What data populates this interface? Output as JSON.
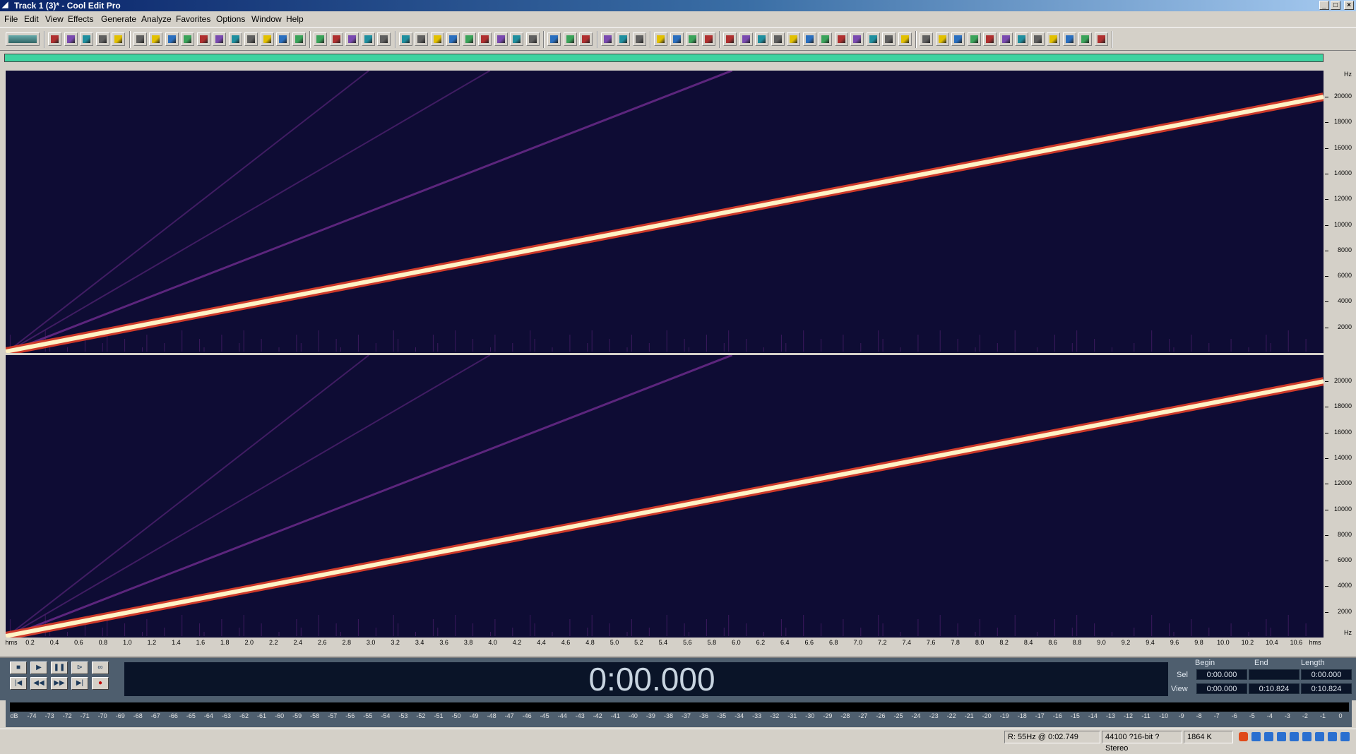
{
  "window": {
    "title": "Track 1 (3)* - Cool Edit Pro",
    "icon": "cool-edit-logo-icon",
    "buttons": {
      "minimize": "_",
      "maximize": "□",
      "close": "×"
    }
  },
  "menu": [
    "File",
    "Edit",
    "View",
    "Effects",
    "Generate",
    "Analyze",
    "Favorites",
    "Options",
    "Window",
    "Help"
  ],
  "toolbar": {
    "groups": [
      [
        "multitrack-icon"
      ],
      [
        "new-file-icon",
        "open-file-icon",
        "save-icon",
        "save-as-icon",
        "close-file-icon"
      ],
      [
        "undo-icon",
        "redo-icon",
        "repeat-icon",
        "copy-icon",
        "cut-icon",
        "paste-icon",
        "paste-new-icon",
        "mix-paste-icon",
        "trim-icon",
        "delete-icon",
        "silence-icon"
      ],
      [
        "waveform-view-icon",
        "spectral-view-icon",
        "zoom-in-icon",
        "zoom-out-icon",
        "zoom-full-icon"
      ],
      [
        "cue-list-icon",
        "play-list-icon",
        "snap-icon",
        "play-icon",
        "mark-icon",
        "time-format-icon",
        "grid-icon",
        "info-icon",
        "level-icon"
      ],
      [
        "settings-icon",
        "keyboard-icon",
        "help-icon"
      ],
      [
        "stats-icon",
        "find-icon",
        "zoom-region-icon"
      ],
      [
        "amplify-icon",
        "envelope-icon",
        "normalize-icon",
        "fade-icon"
      ],
      [
        "chorus-icon",
        "delay-icon",
        "echo-icon",
        "reverb-icon",
        "flanger-icon",
        "pitch-icon",
        "stretch-icon",
        "eq-icon",
        "filter-icon",
        "noise-icon",
        "hiss-icon",
        "click-icon"
      ],
      [
        "analyze-icon",
        "timer-icon",
        "gear-icon",
        "dynamics-icon",
        "wave-icon",
        "sine-icon",
        "tone-icon",
        "dtmf-icon",
        "brainwave-icon",
        "sweep-icon",
        "harmonic-icon",
        "spectrum-icon"
      ]
    ]
  },
  "spectrogram": {
    "hz_unit": "Hz",
    "hz_labels": [
      "20000",
      "18000",
      "16000",
      "14000",
      "12000",
      "10000",
      "8000",
      "6000",
      "4000",
      "2000"
    ],
    "bottom_hz_unit": "Hz",
    "time_labels": [
      "hms",
      "0.2",
      "0.4",
      "0.6",
      "0.8",
      "1.0",
      "1.2",
      "1.4",
      "1.6",
      "1.8",
      "2.0",
      "2.2",
      "2.4",
      "2.6",
      "2.8",
      "3.0",
      "3.2",
      "3.4",
      "3.6",
      "3.8",
      "4.0",
      "4.2",
      "4.4",
      "4.6",
      "4.8",
      "5.0",
      "5.2",
      "5.4",
      "5.6",
      "5.8",
      "6.0",
      "6.2",
      "6.4",
      "6.6",
      "6.8",
      "7.0",
      "7.2",
      "7.4",
      "7.6",
      "7.8",
      "8.0",
      "8.2",
      "8.4",
      "8.6",
      "8.8",
      "9.0",
      "9.2",
      "9.4",
      "9.6",
      "9.8",
      "10.0",
      "10.2",
      "10.4",
      "10.6",
      "hms"
    ],
    "background_color": "#0e0c34",
    "sweep_color": "#fff3c6",
    "glow_color": "#e2402a",
    "harmonic_color": "#6a2a8a",
    "sweep_end_hz": 20000,
    "max_hz": 22050
  },
  "transport": {
    "time": "0:00.000",
    "buttons": [
      "stop-icon",
      "play-icon",
      "pause-icon",
      "play-to-end-icon",
      "loop-icon",
      "go-start-icon",
      "rewind-icon",
      "fast-forward-icon",
      "go-end-icon",
      "record-icon"
    ],
    "selection": {
      "headers": {
        "begin": "Begin",
        "end": "End",
        "length": "Length"
      },
      "sel_label": "Sel",
      "view_label": "View",
      "sel_begin": "0:00.000",
      "sel_end": "",
      "sel_length": "0:00.000",
      "view_begin": "0:00.000",
      "view_end": "0:10.824",
      "view_length": "0:10.824"
    }
  },
  "level_meter": {
    "scale": [
      "dB",
      "-74",
      "-73",
      "-72",
      "-71",
      "-70",
      "-69",
      "-68",
      "-67",
      "-66",
      "-65",
      "-64",
      "-63",
      "-62",
      "-61",
      "-60",
      "-59",
      "-58",
      "-57",
      "-56",
      "-55",
      "-54",
      "-53",
      "-52",
      "-51",
      "-50",
      "-49",
      "-48",
      "-47",
      "-46",
      "-45",
      "-44",
      "-43",
      "-42",
      "-41",
      "-40",
      "-39",
      "-38",
      "-37",
      "-36",
      "-35",
      "-34",
      "-33",
      "-32",
      "-31",
      "-30",
      "-29",
      "-28",
      "-27",
      "-26",
      "-25",
      "-24",
      "-23",
      "-22",
      "-21",
      "-20",
      "-19",
      "-18",
      "-17",
      "-16",
      "-15",
      "-14",
      "-13",
      "-12",
      "-11",
      "-10",
      "-9",
      "-8",
      "-7",
      "-6",
      "-5",
      "-4",
      "-3",
      "-2",
      "-1",
      "0"
    ]
  },
  "status": {
    "cursor": "R: 55Hz @  0:02.749",
    "format": "44100 ?16-bit ?Stereo",
    "size": "1864 K"
  },
  "tray": [
    "ime-sogou-icon",
    "ime-chinese-icon",
    "moon-icon",
    "punctuation-icon",
    "emoji-icon",
    "keyboard-icon",
    "skin-icon",
    "shirt-icon",
    "tools-icon"
  ]
}
